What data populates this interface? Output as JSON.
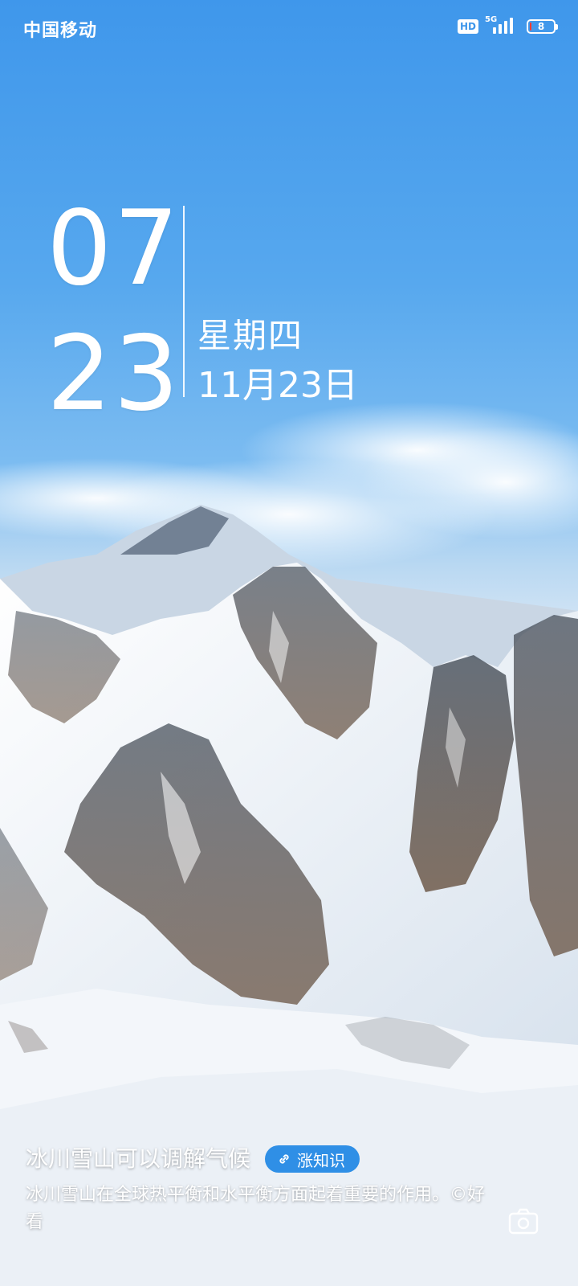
{
  "status_bar": {
    "carrier": "中国移动",
    "hd_label": "HD",
    "network_type": "5G",
    "battery_level": "8",
    "battery_fraction": 0.08,
    "signal_bars": 4
  },
  "lock_screen": {
    "hour": "07",
    "minute": "23",
    "weekday": "星期四",
    "date": "11月23日"
  },
  "wallpaper_info": {
    "title": "冰川雪山可以调解气候",
    "learn_more_label": "涨知识",
    "description": "冰川雪山在全球热平衡和水平衡方面起着重要的作用。©好看"
  },
  "icons": {
    "link": "link-icon",
    "camera": "camera-icon",
    "hd": "hd-icon",
    "signal": "signal-icon",
    "battery": "battery-icon"
  },
  "colors": {
    "sky_top": "#3f97eb",
    "chip_blue": "#2f8fe6",
    "battery_low": "#ff3b30",
    "text": "#ffffff"
  }
}
